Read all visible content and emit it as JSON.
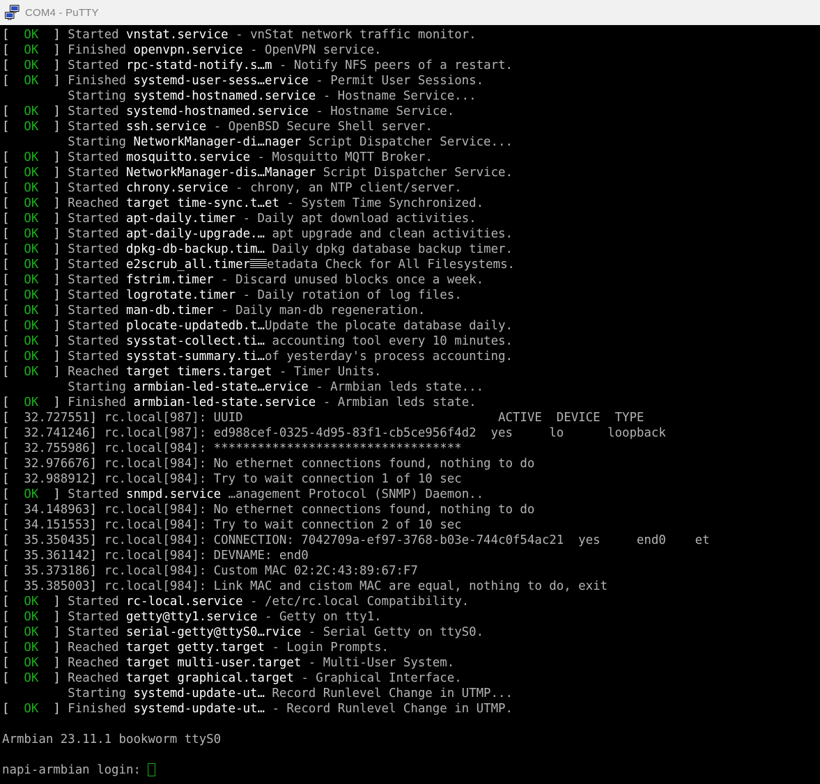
{
  "window": {
    "title": "COM4 - PuTTY",
    "icon": "putty-icon",
    "titlebar_color": "#f1f1f1",
    "title_text_color": "#808080"
  },
  "terminal": {
    "background": "#000000",
    "foreground": "#b4b4b4",
    "bright_color": "#ffffff",
    "ok_color": "#18b018",
    "cursor_color": "#18b018",
    "cursor_style": "hollow-block",
    "columns": 97,
    "rows": 49
  },
  "lines": [
    {
      "status": "OK",
      "verb": "Started",
      "unit": "vnstat.service",
      "sep": " - ",
      "desc": "vnStat network traffic monitor."
    },
    {
      "status": "OK",
      "verb": "Finished",
      "unit": "openvpn.service",
      "sep": " - ",
      "desc": "OpenVPN service."
    },
    {
      "status": "OK",
      "verb": "Started",
      "unit": "rpc-statd-notify.s…m",
      "sep": " - ",
      "desc": "Notify NFS peers of a restart."
    },
    {
      "status": "OK",
      "verb": "Finished",
      "unit": "systemd-user-sess…ervice",
      "sep": " - ",
      "desc": "Permit User Sessions."
    },
    {
      "status": "",
      "verb": "Starting",
      "unit": "systemd-hostnamed.service",
      "sep": " - ",
      "desc": "Hostname Service..."
    },
    {
      "status": "OK",
      "verb": "Started",
      "unit": "systemd-hostnamed.service",
      "sep": " - ",
      "desc": "Hostname Service."
    },
    {
      "status": "OK",
      "verb": "Started",
      "unit": "ssh.service",
      "sep": " - ",
      "desc": "OpenBSD Secure Shell server."
    },
    {
      "status": "",
      "verb": "Starting",
      "unit": "NetworkManager-di…nager",
      "sep": " ",
      "desc": "Script Dispatcher Service..."
    },
    {
      "status": "OK",
      "verb": "Started",
      "unit": "mosquitto.service",
      "sep": " - ",
      "desc": "Mosquitto MQTT Broker."
    },
    {
      "status": "OK",
      "verb": "Started",
      "unit": "NetworkManager-dis…Manager",
      "sep": " ",
      "desc": "Script Dispatcher Service."
    },
    {
      "status": "OK",
      "verb": "Started",
      "unit": "chrony.service",
      "sep": " - ",
      "desc": "chrony, an NTP client/server."
    },
    {
      "status": "OK",
      "verb": "Reached",
      "unit": "target time-sync.t…et",
      "sep": " - ",
      "desc": "System Time Synchronized."
    },
    {
      "status": "OK",
      "verb": "Started",
      "unit": "apt-daily.timer",
      "sep": " - ",
      "desc": "Daily apt download activities."
    },
    {
      "status": "OK",
      "verb": "Started",
      "unit": "apt-daily-upgrade.…",
      "sep": " ",
      "desc": "apt upgrade and clean activities."
    },
    {
      "status": "OK",
      "verb": "Started",
      "unit": "dpkg-db-backup.tim…",
      "sep": " ",
      "desc": "Daily dpkg database backup timer."
    },
    {
      "status": "OK",
      "verb": "Started",
      "unit": "e2scrub_all.timer",
      "sep": "",
      "garble": true,
      "desc": "etadata Check for All Filesystems."
    },
    {
      "status": "OK",
      "verb": "Started",
      "unit": "fstrim.timer",
      "sep": " - ",
      "desc": "Discard unused blocks once a week."
    },
    {
      "status": "OK",
      "verb": "Started",
      "unit": "logrotate.timer",
      "sep": " - ",
      "desc": "Daily rotation of log files."
    },
    {
      "status": "OK",
      "verb": "Started",
      "unit": "man-db.timer",
      "sep": " - ",
      "desc": "Daily man-db regeneration."
    },
    {
      "status": "OK",
      "verb": "Started",
      "unit": "plocate-updatedb.t…",
      "sep": "",
      "desc": "Update the plocate database daily."
    },
    {
      "status": "OK",
      "verb": "Started",
      "unit": "sysstat-collect.ti…",
      "sep": " ",
      "desc": "accounting tool every 10 minutes."
    },
    {
      "status": "OK",
      "verb": "Started",
      "unit": "sysstat-summary.ti…",
      "sep": "",
      "desc": "of yesterday's process accounting."
    },
    {
      "status": "OK",
      "verb": "Reached",
      "unit": "target timers.target",
      "sep": " - ",
      "desc": "Timer Units."
    },
    {
      "status": "",
      "verb": "Starting",
      "unit": "armbian-led-state…ervice",
      "sep": " - ",
      "desc": "Armbian leds state..."
    },
    {
      "status": "OK",
      "verb": "Finished",
      "unit": "armbian-led-state.service",
      "sep": " - ",
      "desc": "Armbian leds state."
    },
    {
      "kernel": true,
      "time": "32.727551",
      "src": "rc.local[987]",
      "msg": "UUID                                   ACTIVE  DEVICE  TYPE"
    },
    {
      "kernel": true,
      "time": "32.741246",
      "src": "rc.local[987]",
      "msg": "ed988cef-0325-4d95-83f1-cb5ce956f4d2  yes     lo      loopback"
    },
    {
      "kernel": true,
      "time": "32.755986",
      "src": "rc.local[984]",
      "msg": "**********************************"
    },
    {
      "kernel": true,
      "time": "32.976676",
      "src": "rc.local[984]",
      "msg": "No ethernet connections found, nothing to do"
    },
    {
      "kernel": true,
      "time": "32.988912",
      "src": "rc.local[984]",
      "msg": "Try to wait connection 1 of 10 sec"
    },
    {
      "status": "OK",
      "verb": "Started",
      "unit": "snmpd.service",
      "sep": " ",
      "desc": "…anagement Protocol (SNMP) Daemon.."
    },
    {
      "kernel": true,
      "time": "34.148963",
      "src": "rc.local[984]",
      "msg": "No ethernet connections found, nothing to do"
    },
    {
      "kernel": true,
      "time": "34.151553",
      "src": "rc.local[984]",
      "msg": "Try to wait connection 2 of 10 sec"
    },
    {
      "kernel": true,
      "time": "35.350435",
      "src": "rc.local[984]",
      "msg": "CONNECTION: 7042709a-ef97-3768-b03e-744c0f54ac21  yes     end0    et"
    },
    {
      "kernel": true,
      "time": "35.361142",
      "src": "rc.local[984]",
      "msg": "DEVNAME: end0"
    },
    {
      "kernel": true,
      "time": "35.373186",
      "src": "rc.local[984]",
      "msg": "Custom MAC 02:2C:43:89:67:F7"
    },
    {
      "kernel": true,
      "time": "35.385003",
      "src": "rc.local[984]",
      "msg": "Link MAC and cistom MAC are equal, nothing to do, exit"
    },
    {
      "status": "OK",
      "verb": "Started",
      "unit": "rc-local.service",
      "sep": " - ",
      "desc": "/etc/rc.local Compatibility."
    },
    {
      "status": "OK",
      "verb": "Started",
      "unit": "getty@tty1.service",
      "sep": " - ",
      "desc": "Getty on tty1."
    },
    {
      "status": "OK",
      "verb": "Started",
      "unit": "serial-getty@ttyS0…rvice",
      "sep": " - ",
      "desc": "Serial Getty on ttyS0."
    },
    {
      "status": "OK",
      "verb": "Reached",
      "unit": "target getty.target",
      "sep": " - ",
      "desc": "Login Prompts."
    },
    {
      "status": "OK",
      "verb": "Reached",
      "unit": "target multi-user.target",
      "sep": " - ",
      "desc": "Multi-User System."
    },
    {
      "status": "OK",
      "verb": "Reached",
      "unit": "target graphical.target",
      "sep": " - ",
      "desc": "Graphical Interface."
    },
    {
      "status": "",
      "verb": "Starting",
      "unit": "systemd-update-ut…",
      "sep": " ",
      "desc": "Record Runlevel Change in UTMP..."
    },
    {
      "status": "OK",
      "verb": "Finished",
      "unit": "systemd-update-ut…",
      "sep": " - ",
      "desc": "Record Runlevel Change in UTMP."
    }
  ],
  "footer": {
    "banner": "Armbian 23.11.1 bookworm ttyS0",
    "prompt": "napi-armbian login: "
  }
}
